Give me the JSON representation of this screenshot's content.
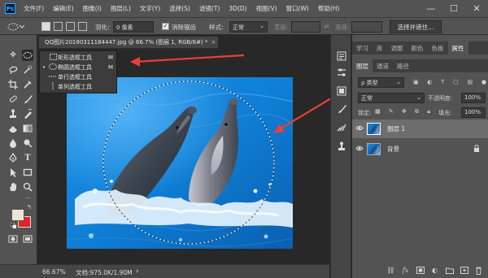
{
  "app": {
    "logo_text": "Ps"
  },
  "menu": {
    "items": [
      "文件(F)",
      "编辑(E)",
      "图像(I)",
      "图层(L)",
      "文字(Y)",
      "选择(S)",
      "滤镜(T)",
      "3D(D)",
      "视图(V)",
      "窗口(W)",
      "帮助(H)"
    ]
  },
  "window_controls": {
    "minimize": "—",
    "maximize": "☐",
    "close": "✕"
  },
  "options": {
    "feather_label": "羽化:",
    "feather_value": "0 像素",
    "antialias_label": "消除锯齿",
    "style_label": "样式:",
    "style_value": "正常",
    "width_label": "宽度:",
    "height_label": "高度:",
    "select_mask_button": "选择并遮住..."
  },
  "document": {
    "tab_title": "QQ图片20180311184447.jpg @ 66.7% (图层 1, RGB/8#) *",
    "tab_close": "×"
  },
  "flyout": {
    "items": [
      {
        "selected": false,
        "label": "矩形选框工具",
        "shortcut": "M"
      },
      {
        "selected": true,
        "label": "椭圆选框工具",
        "shortcut": "M"
      },
      {
        "selected": false,
        "label": "单行选框工具",
        "shortcut": ""
      },
      {
        "selected": false,
        "label": "单列选框工具",
        "shortcut": ""
      }
    ],
    "selected_marker": "•"
  },
  "status": {
    "zoom": "66.67%",
    "doc_info": "文档:975.0K/1.90M",
    "arrow": "›"
  },
  "panels": {
    "top_tabs": [
      "学习",
      "库",
      "调整",
      "颜色",
      "色板",
      "属性"
    ],
    "top_active": 5,
    "layer_tabs": [
      "图层",
      "通道",
      "路径"
    ],
    "layer_active": 0,
    "kind_filter": "ρ 类型",
    "blend_mode": "正常",
    "opacity_label": "不透明度:",
    "opacity_value": "100%",
    "lock_label": "锁定:",
    "fill_label": "填充:",
    "fill_value": "100%"
  },
  "layers": [
    {
      "name": "图层 1",
      "selected": true,
      "locked": false
    },
    {
      "name": "背景",
      "selected": false,
      "locked": true
    }
  ],
  "colors": {
    "foreground": "#ece4d4",
    "background": "#e8221f",
    "water": "#0f7fd6",
    "arrow": "#e8403a"
  }
}
